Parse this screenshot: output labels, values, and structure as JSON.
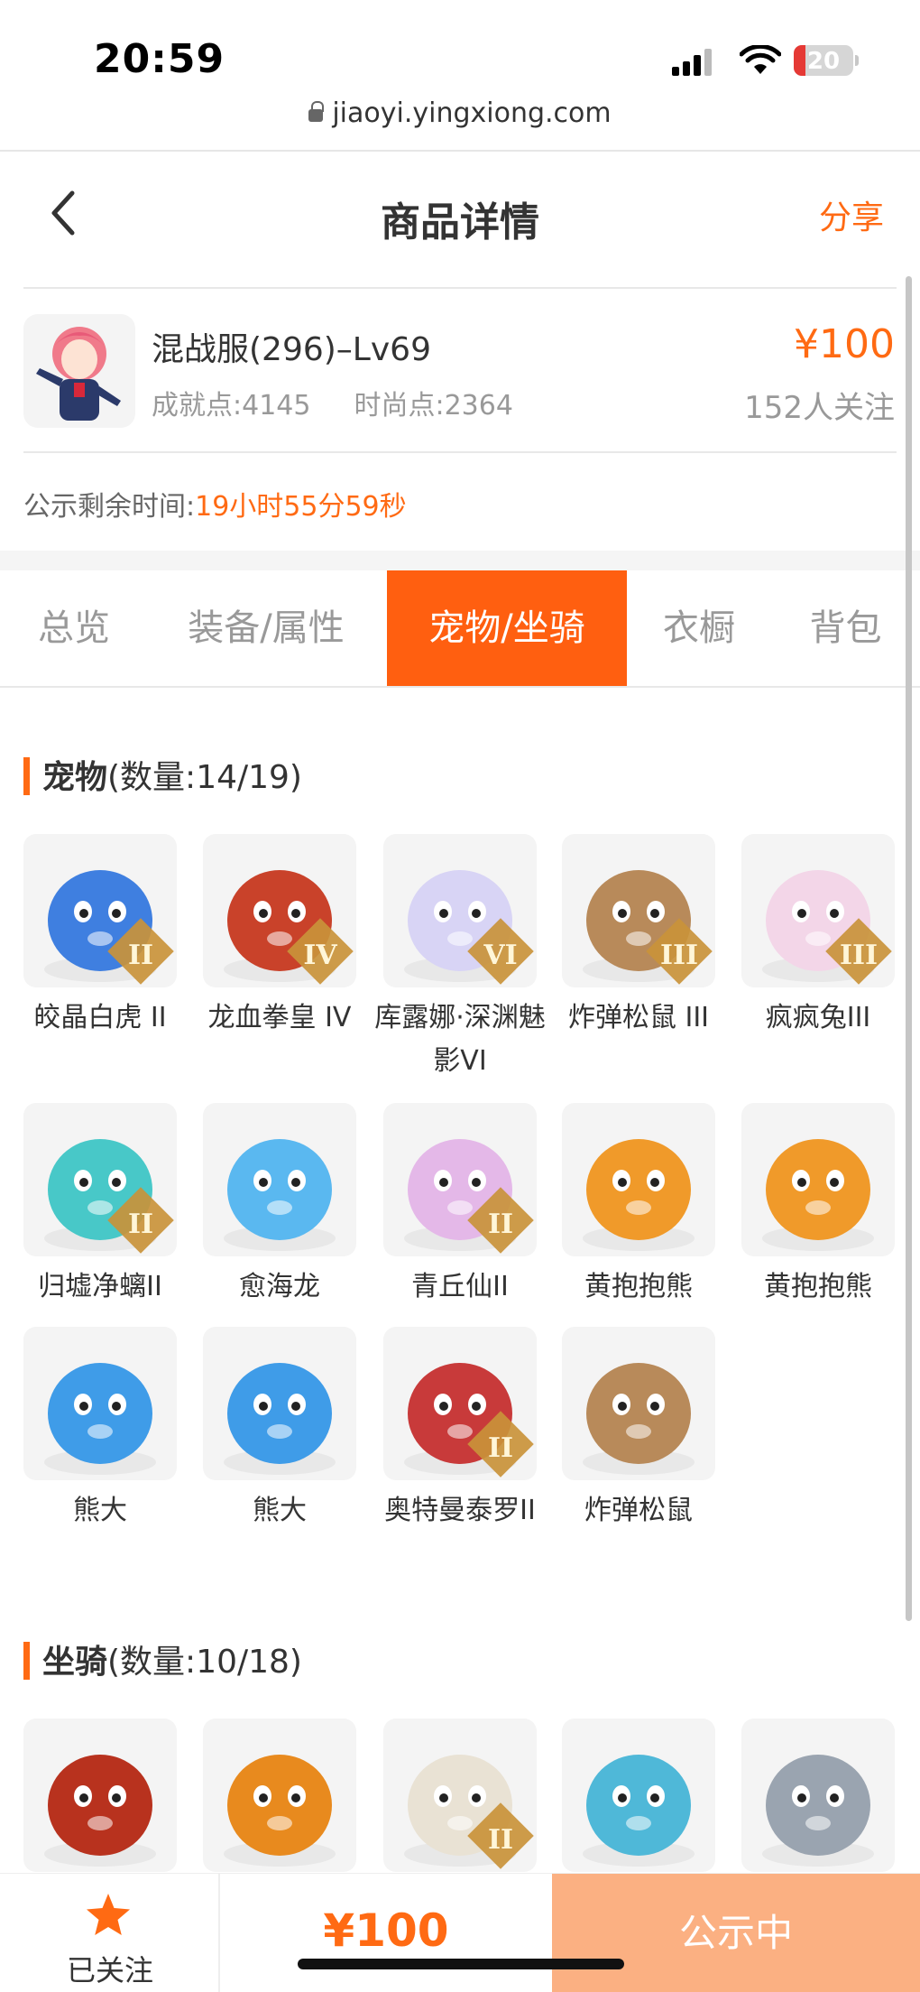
{
  "status_bar": {
    "time": "20:59",
    "battery": "20",
    "battery_level": 0.2
  },
  "browser": {
    "url": "jiaoyi.yingxiong.com"
  },
  "header": {
    "title": "商品详情",
    "share": "分享"
  },
  "product": {
    "title": "混战服(296)–Lv69",
    "achievement": "成就点:4145",
    "fashion": "时尚点:2364",
    "price": "¥100",
    "followers": "152人关注",
    "timer_label": "公示剩余时间:",
    "timer_value": "19小时55分59秒"
  },
  "tabs": [
    {
      "label": "总览"
    },
    {
      "label": "装备/属性"
    },
    {
      "label": "宠物/坐骑"
    },
    {
      "label": "衣橱"
    },
    {
      "label": "背包"
    }
  ],
  "pets_section": {
    "title": "宠物",
    "count": "(数量:14/19)"
  },
  "pets": [
    {
      "name": "皎晶白虎 II",
      "badge": "II",
      "color": "#3f7fe0"
    },
    {
      "name": "龙血拳皇 IV",
      "badge": "IV",
      "color": "#c9422a"
    },
    {
      "name": "库露娜·深渊魅影VI",
      "badge": "VI",
      "color": "#d8d4f5"
    },
    {
      "name": "炸弹松鼠 III",
      "badge": "III",
      "color": "#b88a5a"
    },
    {
      "name": "疯疯兔III",
      "badge": "III",
      "color": "#f3d6e8"
    },
    {
      "name": "归墟净螭II",
      "badge": "II",
      "color": "#48c8c8"
    },
    {
      "name": "愈海龙",
      "badge": "",
      "color": "#5ab8f0"
    },
    {
      "name": "青丘仙II",
      "badge": "II",
      "color": "#e4b8e8"
    },
    {
      "name": "黄抱抱熊",
      "badge": "",
      "color": "#f09a2a"
    },
    {
      "name": "黄抱抱熊",
      "badge": "",
      "color": "#f09a2a"
    },
    {
      "name": "熊大",
      "badge": "",
      "color": "#3f9ce8"
    },
    {
      "name": "熊大",
      "badge": "",
      "color": "#3f9ce8"
    },
    {
      "name": "奥特曼泰罗II",
      "badge": "II",
      "color": "#c83a3a"
    },
    {
      "name": "炸弹松鼠",
      "badge": "",
      "color": "#b88a5a"
    }
  ],
  "mounts_section": {
    "title": "坐骑",
    "count": "(数量:10/18)"
  },
  "mounts": [
    {
      "badge": "",
      "color": "#b8321e"
    },
    {
      "badge": "",
      "color": "#e88a1e"
    },
    {
      "badge": "II",
      "color": "#e9e2d4"
    },
    {
      "badge": "",
      "color": "#4fb8d8"
    },
    {
      "badge": "",
      "color": "#9aa4b0"
    }
  ],
  "bottom_bar": {
    "follow_label": "已关注",
    "price": "¥100",
    "status": "公示中"
  }
}
